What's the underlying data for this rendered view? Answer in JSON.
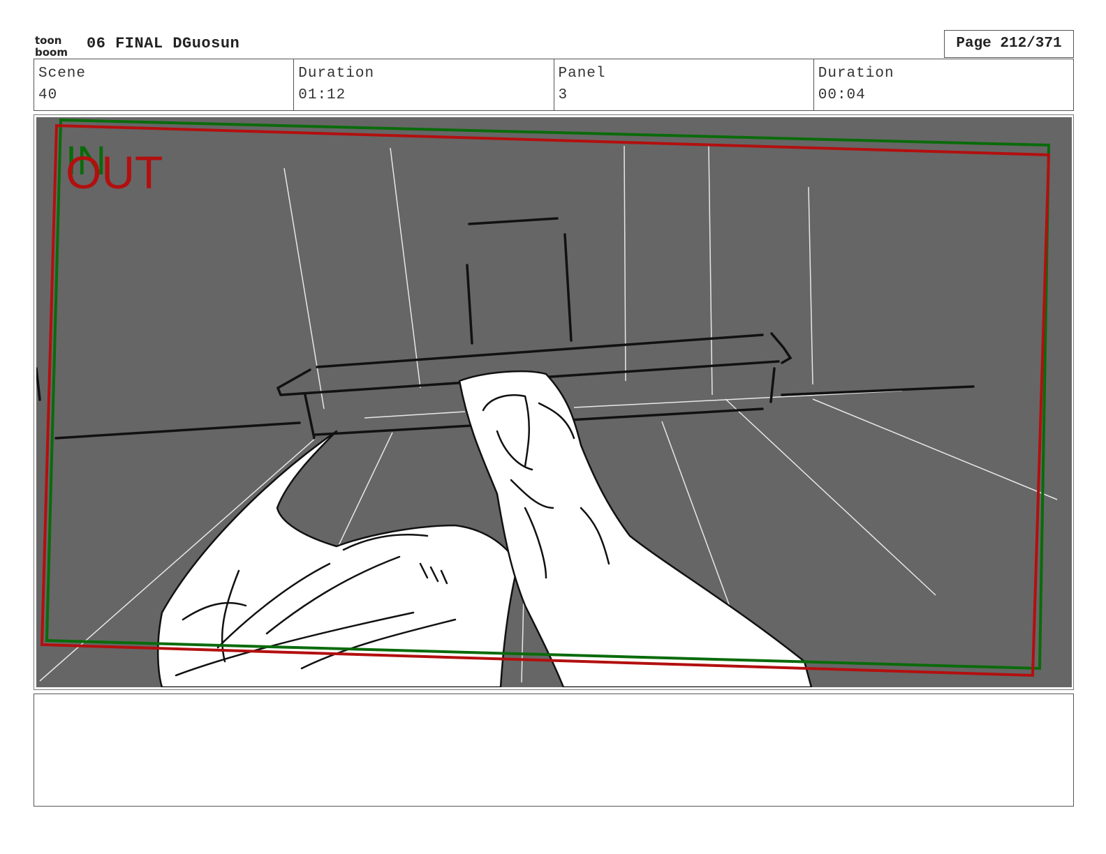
{
  "header": {
    "logo_text_top": "toon",
    "logo_text_bottom": "boom",
    "project_title": "06 FINAL DGuosun",
    "page_label": "Page 212/371"
  },
  "info": {
    "scene_label": "Scene",
    "scene_value": "40",
    "scene_duration_label": "Duration",
    "scene_duration_value": "01:12",
    "panel_label": "Panel",
    "panel_value": "3",
    "panel_duration_label": "Duration",
    "panel_duration_value": "00:04"
  },
  "panel": {
    "in_label": "IN",
    "out_label": "OUT",
    "colors": {
      "background": "#666666",
      "in_frame": "#0a6b0a",
      "out_frame": "#b30f0f",
      "drawing": "#ffffff"
    }
  },
  "notes": {
    "text": ""
  }
}
